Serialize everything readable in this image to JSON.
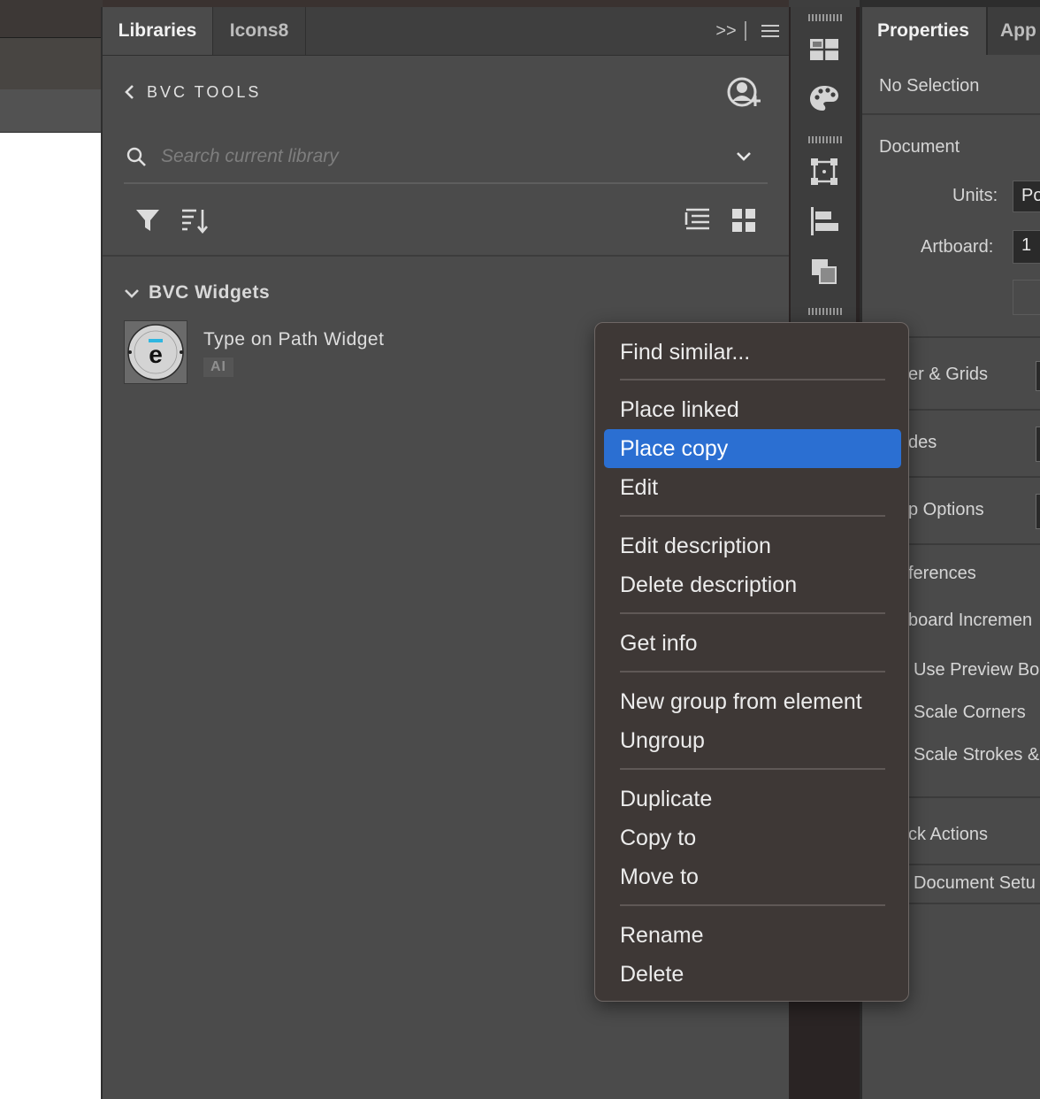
{
  "libraries_panel": {
    "tabs": [
      {
        "label": "Libraries",
        "active": true
      },
      {
        "label": "Icons8",
        "active": false
      }
    ],
    "collapse_glyph": ">>",
    "library_name": "BVC TOOLS",
    "search": {
      "placeholder": "Search current library",
      "value": ""
    },
    "group": {
      "name": "BVC Widgets",
      "items": [
        {
          "name": "Type on Path Widget",
          "type": "AI",
          "thumbnail_letter": "e"
        }
      ]
    }
  },
  "properties_panel": {
    "tabs": [
      {
        "label": "Properties",
        "active": true
      },
      {
        "label": "App",
        "active": false
      }
    ],
    "selection_status": "No Selection",
    "document_heading": "Document",
    "units_label": "Units:",
    "units_value": "Po",
    "artboard_label": "Artboard:",
    "artboard_value": "1",
    "visible_rows": [
      "er & Grids",
      "des",
      "p Options",
      "ferences",
      "board Incremen",
      "Use Preview Bo",
      "Scale Corners",
      "Scale Strokes &",
      "ck Actions",
      "Document Setu"
    ]
  },
  "context_menu": {
    "items": [
      "Find similar...",
      "Place linked",
      "Place copy",
      "Edit",
      "Edit description",
      "Delete description",
      "Get info",
      "New group from element",
      "Ungroup",
      "Duplicate",
      "Copy to",
      "Move to",
      "Rename",
      "Delete"
    ],
    "highlighted": "Place copy"
  },
  "colors": {
    "menu_highlight": "#2b6fd2",
    "panel_bg": "#4b4b4b",
    "menu_bg": "#3e3836",
    "thumbnail_accent": "#2fb6e0"
  }
}
